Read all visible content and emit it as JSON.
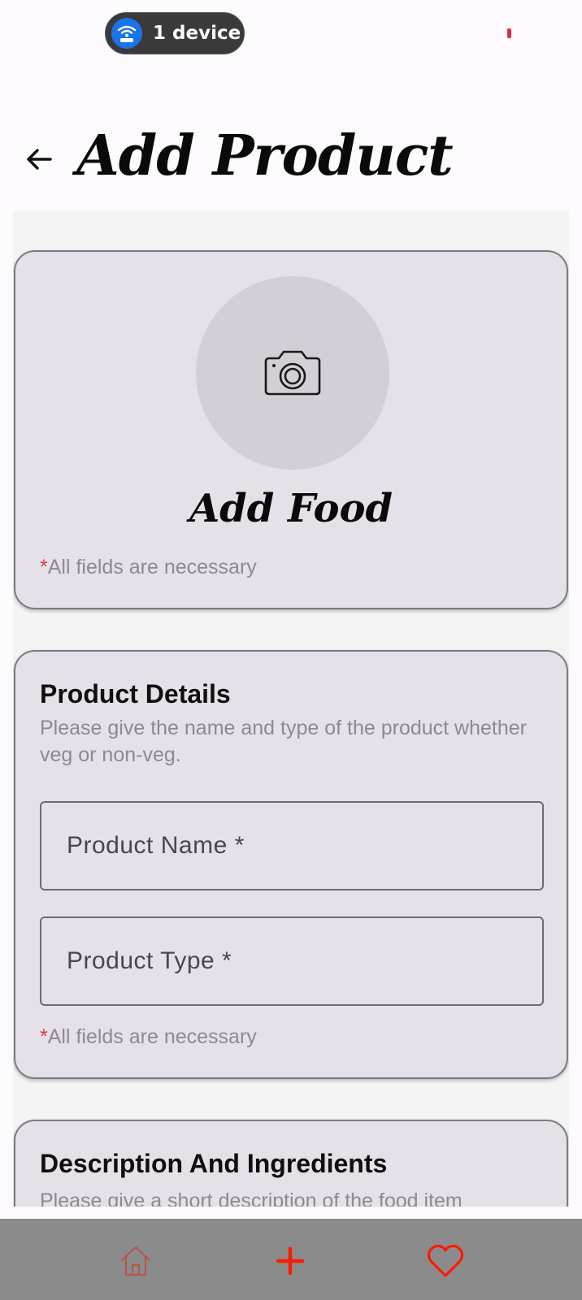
{
  "status_bar": {
    "device_label": "1 device",
    "icons": [
      "wifi-hotspot-icon",
      "recording-indicator"
    ]
  },
  "header": {
    "back_icon": "arrow-left-icon",
    "title": "Add Product"
  },
  "photo_card": {
    "camera_icon": "camera-icon",
    "title": "Add Food",
    "note_star": "*",
    "note": "All fields are necessary"
  },
  "details_card": {
    "title": "Product Details",
    "subtitle": "Please give the name and type of the product whether veg or non-veg.",
    "fields": [
      {
        "label": "Product Name *"
      },
      {
        "label": "Product Type *"
      }
    ],
    "note_star": "*",
    "note": "All fields are necessary"
  },
  "description_card": {
    "title": "Description And Ingredients",
    "subtitle": "Please give a short description of the food item"
  },
  "bottom_nav": {
    "items": [
      {
        "icon": "home-icon",
        "color": "#b0584b"
      },
      {
        "icon": "plus-icon",
        "color": "#ff1a00"
      },
      {
        "icon": "heart-icon",
        "color": "#ff1a00"
      }
    ]
  },
  "colors": {
    "card_bg": "#e6e0e9",
    "required_star": "#e53935",
    "nav_bg": "#8c8b8c"
  }
}
